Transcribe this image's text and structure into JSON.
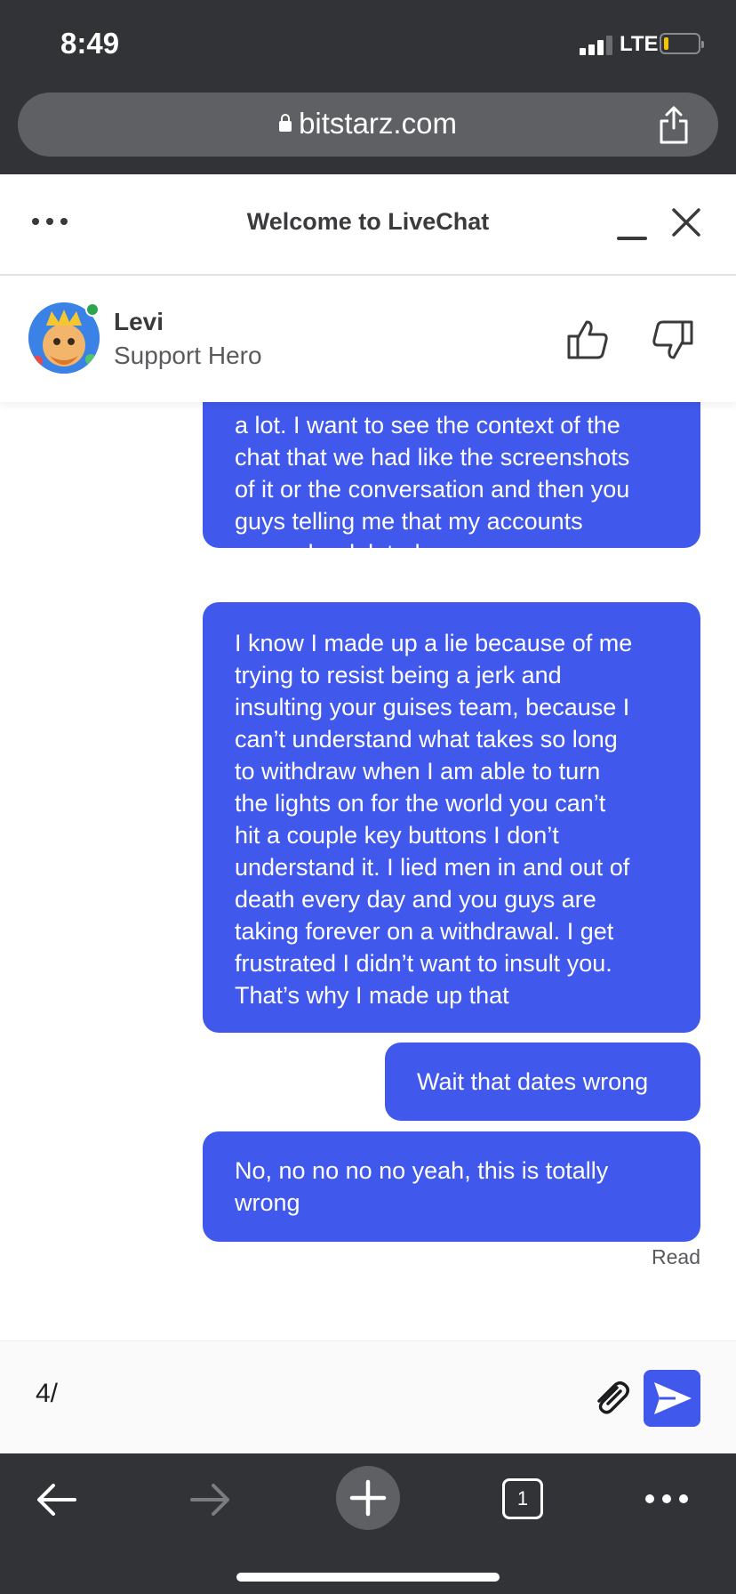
{
  "status_bar": {
    "time": "8:49",
    "network": "LTE",
    "signal_bars": 3,
    "battery_level": 0.1
  },
  "browser": {
    "url": "bitstarz.com",
    "tab_count": "1"
  },
  "chat_header": {
    "title": "Welcome to LiveChat"
  },
  "agent": {
    "name": "Levi",
    "role": "Support Hero",
    "status_color": "#2ea44f"
  },
  "messages": [
    {
      "text": "a lot. I want to see the context of the\nchat that we had like the screenshots\nof it or the conversation and then you\nguys telling me that my accounts\ngonna be deleted"
    },
    {
      "text": "I know I made up a lie because of me\ntrying to resist being a jerk and\ninsulting your guises team, because I\ncan’t understand what takes so long\nto withdraw when I am able to turn\nthe lights on for the world you can’t\nhit a couple key buttons I don’t\nunderstand it. I lied men in and out of\ndeath every day and you guys are\ntaking forever on a withdrawal. I get\nfrustrated I didn’t want to insult you.\nThat’s why I made up that"
    },
    {
      "text": "Wait that dates wrong"
    },
    {
      "text": "No, no no no no yeah, this is totally\nwrong"
    }
  ],
  "read_receipt": "Read",
  "composer": {
    "value": "4/"
  },
  "colors": {
    "bubble": "#4058ec",
    "chrome": "#323336"
  },
  "icons": {
    "menu": "ellipsis-icon",
    "minimize": "minimize-icon",
    "close": "close-icon",
    "like": "thumbs-up-icon",
    "dislike": "thumbs-down-icon",
    "attach": "paperclip-icon",
    "send": "send-icon",
    "share": "share-icon",
    "back": "arrow-left-icon",
    "forward": "arrow-right-icon",
    "new_tab": "plus-icon",
    "more": "ellipsis-icon"
  }
}
